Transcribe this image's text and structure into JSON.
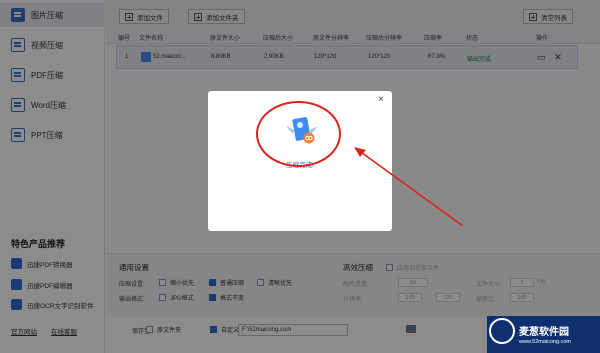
{
  "sidebar": {
    "items": [
      {
        "label": "图片压缩",
        "active": true
      },
      {
        "label": "视频压缩"
      },
      {
        "label": "PDF压缩"
      },
      {
        "label": "Word压缩"
      },
      {
        "label": "PPT压缩"
      }
    ],
    "promo_title": "特色产品推荐",
    "promo_items": [
      "迅捷PDF转换器",
      "迅捷PDF编辑器",
      "迅捷OCR文字识别软件"
    ],
    "links": [
      "官方网站",
      "在线客服"
    ]
  },
  "toolbar": {
    "add_file": "添加文件",
    "add_folder": "添加文件夹",
    "clear_list": "清空列表"
  },
  "table": {
    "headers": [
      "编号",
      "文件名称",
      "原文件大小",
      "压缩后大小",
      "原文件分辨率",
      "压缩后分辨率",
      "压缩率",
      "状态",
      "操作"
    ],
    "rows": [
      {
        "index": "1",
        "name": "52.maicon...",
        "orig_size": "8.89KB",
        "new_size": "2.90KB",
        "orig_res": "120*120",
        "new_res": "120*120",
        "ratio": "67.3%",
        "status": "输出完成"
      }
    ]
  },
  "settings": {
    "title": "通用设置",
    "compress_label": "压缩设置:",
    "opt_small": "缩小优先",
    "opt_normal": "普通压缩",
    "opt_clear": "清晰优先",
    "output_label": "输出格式:",
    "opt_jpg": "JPG格式",
    "opt_orig": "格式不变",
    "advanced_title": "高效压缩",
    "adv_apply": "应用到全部文件",
    "adv_quality": "图片质量:",
    "adv_res": "分辨率:",
    "adv_size": "文件大小:",
    "adv_scale": "缩放比:",
    "quality_val": "50",
    "res_w": "120",
    "res_h": "120",
    "size_val": "3",
    "size_unit": "KB",
    "scale_val": "100"
  },
  "footer": {
    "save_label": "保存至:",
    "opt_orig_folder": "原文件夹",
    "opt_custom": "自定义",
    "path": "F:\\52maicong.com"
  },
  "modal": {
    "status_text": "压缩完成!",
    "close": "×"
  },
  "watermark": {
    "name": "麦葱软件园",
    "url": "www.52maicong.com"
  },
  "colors": {
    "accent": "#2d6bd6",
    "annotation_red": "#d9251c",
    "status_done": "#1a8a2a"
  }
}
